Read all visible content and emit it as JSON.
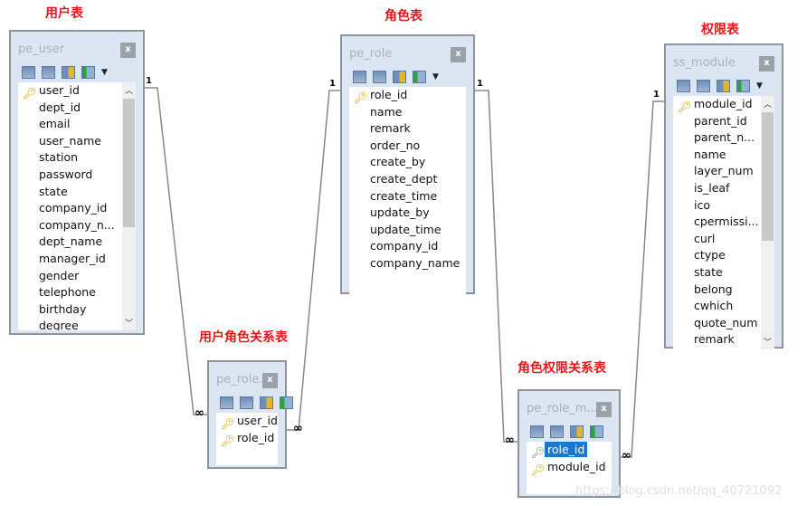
{
  "labels": {
    "user": "用户表",
    "role": "角色表",
    "module": "权限表",
    "user_role": "用户角色关系表",
    "role_module": "角色权限关系表"
  },
  "tables": {
    "pe_user": {
      "title": "pe_user",
      "close": "x",
      "fields": [
        "user_id",
        "dept_id",
        "email",
        "user_name",
        "station",
        "password",
        "state",
        "company_id",
        "company_n...",
        "dept_name",
        "manager_id",
        "gender",
        "telephone",
        "birthday",
        "degree"
      ],
      "keys": [
        0
      ],
      "scroll": true
    },
    "pe_role": {
      "title": "pe_role",
      "close": "x",
      "fields": [
        "role_id",
        "name",
        "remark",
        "order_no",
        "create_by",
        "create_dept",
        "create_time",
        "update_by",
        "update_time",
        "company_id",
        "company_name"
      ],
      "keys": [
        0
      ],
      "scroll": false
    },
    "ss_module": {
      "title": "ss_module",
      "close": "x",
      "fields": [
        "module_id",
        "parent_id",
        "parent_n...",
        "name",
        "layer_num",
        "is_leaf",
        "ico",
        "cpermissi...",
        "curl",
        "ctype",
        "state",
        "belong",
        "cwhich",
        "quote_num",
        "remark"
      ],
      "keys": [
        0
      ],
      "scroll": true
    },
    "pe_role_user": {
      "title": "pe_role...",
      "close": "x",
      "fields": [
        "user_id",
        "role_id"
      ],
      "keys": [
        0,
        1
      ],
      "scroll": false
    },
    "pe_role_module": {
      "title": "pe_role_m...",
      "close": "x",
      "fields": [
        "role_id",
        "module_id"
      ],
      "keys": [
        0,
        1
      ],
      "selected": 0,
      "scroll": false
    }
  },
  "cardinality": {
    "one": "1",
    "many": "∞"
  },
  "watermark": "https://blog.csdn.net/qq_40721092",
  "colors": {
    "label": "#e8141b",
    "selection": "#1979d0"
  }
}
